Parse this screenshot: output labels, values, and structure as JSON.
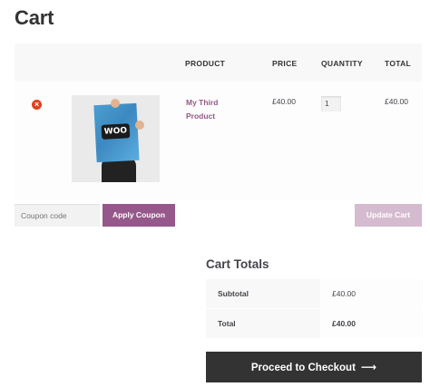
{
  "page": {
    "title": "Cart"
  },
  "cart": {
    "headers": {
      "product": "PRODUCT",
      "price": "PRICE",
      "quantity": "QUANTITY",
      "total": "TOTAL"
    },
    "items": [
      {
        "remove_icon": "×",
        "thumbnail_icon": "product-poster-image",
        "thumbnail_logo": "WOO",
        "name": "My Third Product",
        "price": "£40.00",
        "quantity": "1",
        "total": "£40.00"
      }
    ]
  },
  "actions": {
    "coupon_placeholder": "Coupon code",
    "apply_coupon": "Apply Coupon",
    "update_cart": "Update Cart"
  },
  "totals": {
    "title": "Cart Totals",
    "rows": [
      {
        "label": "Subtotal",
        "value": "£40.00"
      },
      {
        "label": "Total",
        "value": "£40.00"
      }
    ],
    "checkout_label": "Proceed to Checkout",
    "checkout_icon": "⟶"
  },
  "colors": {
    "accent": "#96588a",
    "accent_disabled": "#d5bbd0",
    "remove_red": "#e2401c",
    "dark_button": "#333333"
  }
}
